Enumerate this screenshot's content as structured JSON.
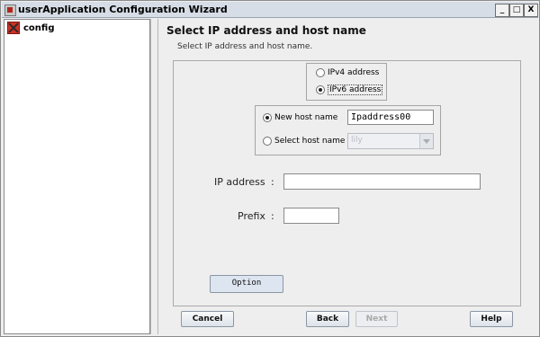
{
  "window": {
    "title": "userApplication Configuration Wizard",
    "controls": {
      "minimize": "_",
      "maximize": "□",
      "close": "X"
    }
  },
  "tree": {
    "items": [
      {
        "label": "config",
        "icon": "config-icon"
      }
    ]
  },
  "page": {
    "title": "Select IP address and host name",
    "subtitle": "Select IP address and host name."
  },
  "address_type": {
    "options": [
      {
        "label": "IPv4 address",
        "selected": false
      },
      {
        "label": "IPv6 address",
        "selected": true
      }
    ]
  },
  "host": {
    "new_label": "New host name",
    "new_value": "Ipaddress00",
    "select_label": "Select host name",
    "select_value": "lily",
    "selected": "new"
  },
  "ip_address": {
    "label": "IP address",
    "separator": ":",
    "value": ""
  },
  "prefix": {
    "label": "Prefix",
    "separator": ":",
    "value": ""
  },
  "buttons": {
    "option": "Option",
    "cancel": "Cancel",
    "back": "Back",
    "next": "Next",
    "help": "Help"
  }
}
